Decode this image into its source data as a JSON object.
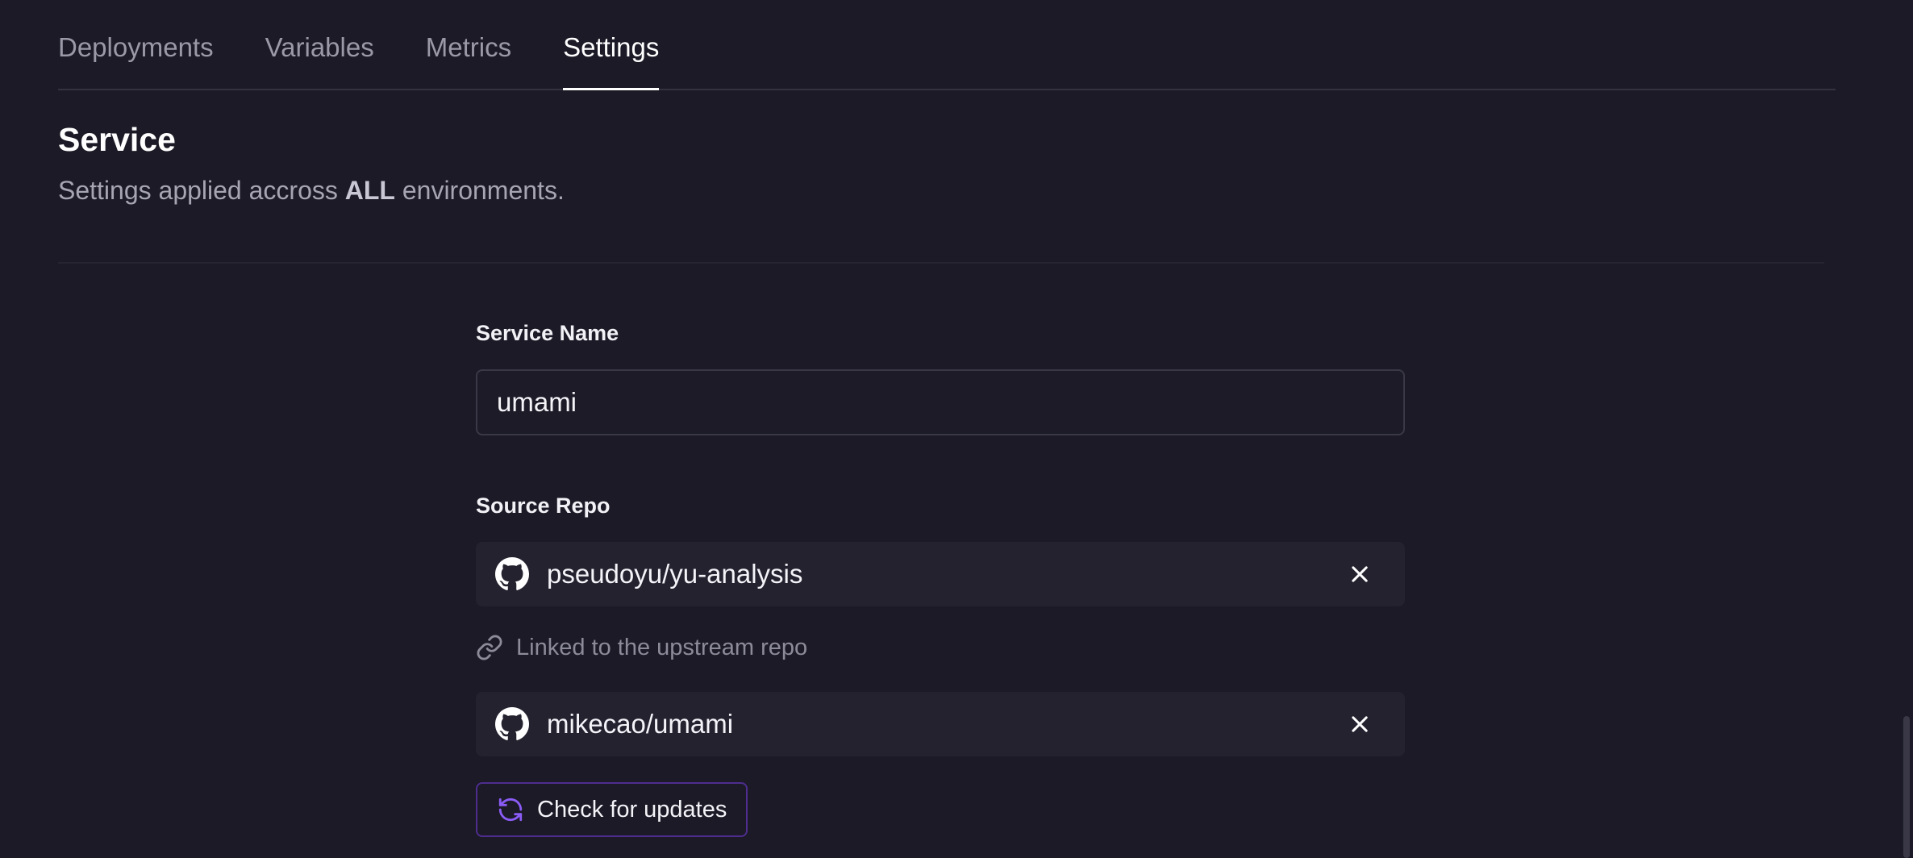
{
  "tabs": [
    {
      "label": "Deployments",
      "active": false
    },
    {
      "label": "Variables",
      "active": false
    },
    {
      "label": "Metrics",
      "active": false
    },
    {
      "label": "Settings",
      "active": true
    }
  ],
  "section": {
    "title": "Service",
    "desc_prefix": "Settings applied accross ",
    "desc_emphasis": "ALL",
    "desc_suffix": " environments."
  },
  "form": {
    "service_name_label": "Service Name",
    "service_name_value": "umami",
    "source_repo_label": "Source Repo",
    "repo_primary": "pseudoyu/yu-analysis",
    "linked_text": "Linked to the upstream repo",
    "repo_upstream": "mikecao/umami",
    "check_updates_label": "Check for updates"
  },
  "icons": {
    "repo": "github-icon",
    "remove": "close-icon",
    "linked": "link-icon",
    "check": "refresh-icon"
  },
  "colors": {
    "background": "#1b1a26",
    "accent": "#8b5cf6",
    "repo_row": "#24222f"
  }
}
